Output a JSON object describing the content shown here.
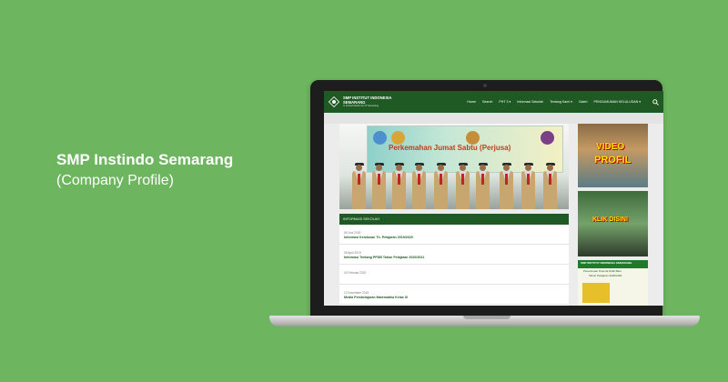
{
  "promo": {
    "title": "SMP Instindo Semarang",
    "subtitle": "(Company Profile)"
  },
  "site": {
    "brand": {
      "name_line1": "SMP INSTITUT INDONESIA",
      "name_line2": "SEMARANG",
      "tagline": "In School Media Go Of Semarang"
    },
    "menu": [
      "Home",
      "Search",
      "PHT 3 ▾",
      "Informasi Sekolah",
      "Tentang Kami ▾",
      "Galeri",
      "PENGUMUMAN KELULUSAN ▾"
    ],
    "slider": {
      "banner_title": "Perkemahan Jumat Sabtu (Perjusa)",
      "banner_line2": "SMP Institut Indonesia Semarang",
      "banner_line3": "Gugus Pramuka Depan 15.057 - 15.058"
    },
    "info": {
      "heading": "INFORMASI SEKOLAH",
      "posts": [
        {
          "date": "05 Juni 2020",
          "title": "Informasi Kelulusan Th. Pelajaran 2019/2020"
        },
        {
          "date": "08 April 2019",
          "title": "Informasi Tentang PPDB Tahun Pelajaran 2020/2021"
        },
        {
          "date": "24 Februari 2020",
          "title": ""
        },
        {
          "date": "12 November 2019",
          "title": "Media Pembelajaran Matematika Kelas IX"
        }
      ]
    },
    "ads": {
      "ad1_line1": "VIDEO",
      "ad1_line2": "PROFIL",
      "ad2_line": "KLIK DISINI",
      "ad3_title": "SMP INSTITUT INDONESIA SEMARANG",
      "ad3_sub": "Penerimaan Peserta Didik Baru",
      "ad3_year": "Tahun Pelajaran 2020/2021"
    }
  },
  "colors": {
    "background": "#6db55f",
    "site_green": "#1f5a25"
  }
}
